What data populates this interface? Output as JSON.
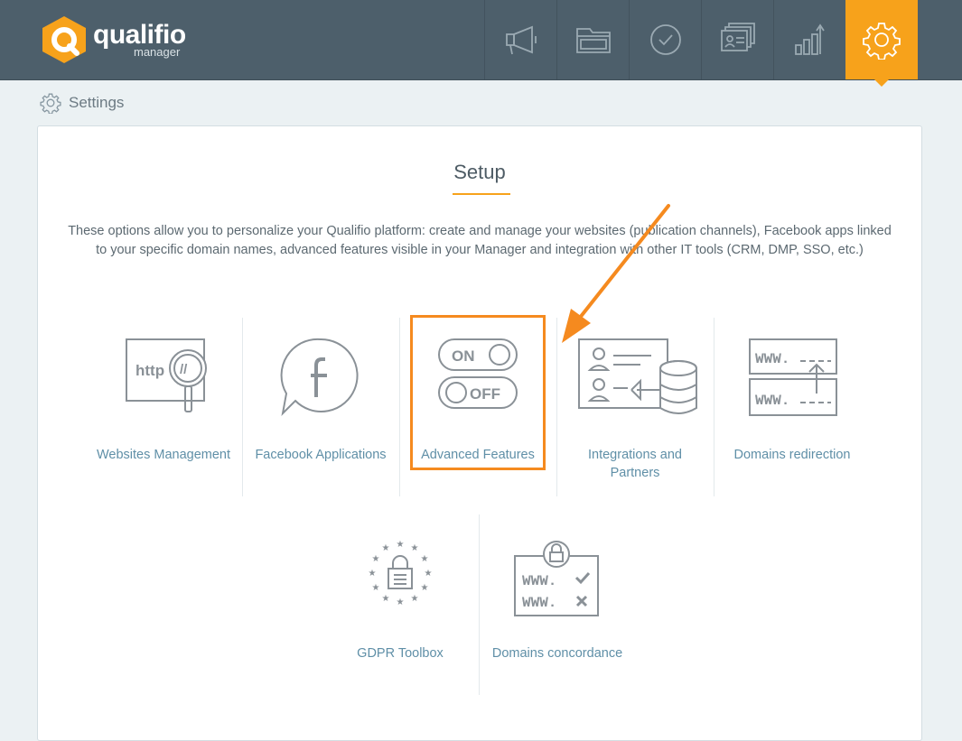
{
  "app": {
    "logo_text": "qualifio",
    "logo_sub": "manager"
  },
  "nav": {
    "items": [
      {
        "name": "campaigns",
        "icon": "megaphone-icon"
      },
      {
        "name": "folders",
        "icon": "folder-icon"
      },
      {
        "name": "validation",
        "icon": "check-circle-icon"
      },
      {
        "name": "contacts",
        "icon": "contact-cards-icon"
      },
      {
        "name": "statistics",
        "icon": "bar-chart-icon"
      },
      {
        "name": "settings",
        "icon": "gear-icon",
        "active": true
      }
    ],
    "accent_color": "#f7a21b",
    "bar_color": "#4d5f6b"
  },
  "breadcrumb": {
    "label": "Settings"
  },
  "setup": {
    "title": "Setup",
    "intro": "These options allow you to personalize your Qualifio platform: create and manage your websites (publication channels), Facebook apps linked to your specific domain names, advanced features visible in your Manager and integration with other IT tools (CRM, DMP, SSO, etc.)",
    "tiles": [
      {
        "label": "Websites Management",
        "icon": "http-magnifier-icon"
      },
      {
        "label": "Facebook Applications",
        "icon": "facebook-bubble-icon"
      },
      {
        "label": "Advanced Features",
        "icon": "on-off-toggle-icon",
        "highlighted": true
      },
      {
        "label": "Integrations and Partners",
        "icon": "integration-database-icon"
      },
      {
        "label": "Domains redirection",
        "icon": "www-redirect-icon"
      },
      {
        "label": "GDPR Toolbox",
        "icon": "eu-lock-icon"
      },
      {
        "label": "Domains concordance",
        "icon": "www-concordance-icon"
      }
    ],
    "toggle_on": "ON",
    "toggle_off": "OFF",
    "http_text": "http",
    "www_text": "WWW."
  }
}
